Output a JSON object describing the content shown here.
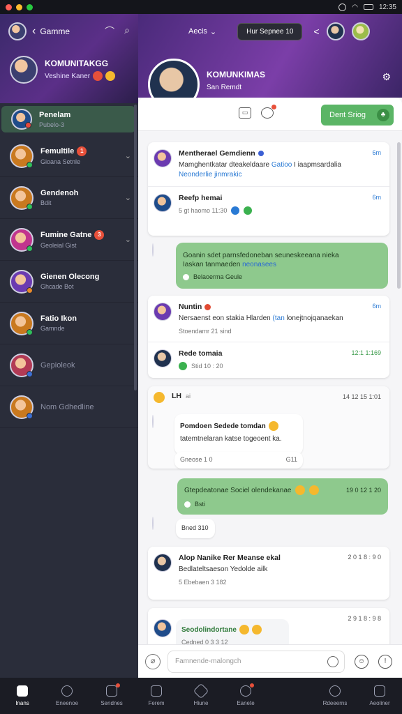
{
  "system": {
    "clock": "12:35"
  },
  "sidebar": {
    "header_title": "Gamme",
    "profile": {
      "title": "KOMUNITAKGG",
      "subtitle": "Veshine Kaner"
    },
    "friends": [
      {
        "name": "Penelam",
        "sub": "Pubelo-3",
        "active": true
      },
      {
        "name": "Femultile",
        "sub": "Gioana Setnle",
        "badge": "1"
      },
      {
        "name": "Gendenoh",
        "sub": "Bdit"
      },
      {
        "name": "Fumine Gatne",
        "sub": "Geoleial Gist",
        "badge": "3"
      },
      {
        "name": "Gienen Olecong",
        "sub": "Ghcade Bot"
      },
      {
        "name": "Fatio Ikon",
        "sub": "Gamnde"
      },
      {
        "name": "Gepioleok",
        "sub": "",
        "dim": true
      },
      {
        "name": "Nom Gdhedline",
        "sub": "",
        "dim": true
      }
    ]
  },
  "header": {
    "tab_label": "Aecis",
    "pill_label": "Hur Sepnee 10",
    "profile": {
      "title": "KOMUNKIMAS",
      "subtitle": "San Remdt"
    },
    "action_button": "Dent Sriog",
    "notif_count": "3"
  },
  "feed": {
    "card1": {
      "row1": {
        "title": "Mentherael Gemdienn",
        "text_a": "Mamghentkatar dteakeldaare ",
        "text_link": "Gatioo",
        "text_b": " I iaapmsardalia",
        "text_link2": "Neonderlie jinmrakic",
        "time": "6m"
      },
      "row2": {
        "title": "Reefp hemai",
        "meta": "5 gt haomo 11:30",
        "time": "6m"
      }
    },
    "green1": {
      "text_a": "Goanin sdet parnsfedoneban seuneskeeana nieka",
      "text_b": "Iaskan tanmaeden ",
      "text_link": "neonasees",
      "meta": "Belaoerma Geule"
    },
    "card2": {
      "row1": {
        "title": "Nuntin",
        "text_a": "Nersaenst eon stakia Hlarden ",
        "text_link": "(tan",
        "text_b": " lonejtnojqanaekan",
        "meta": "Stoendamr 21 sind",
        "time": "6m"
      },
      "row2": {
        "title": "Rede tomaia",
        "meta": "Stid 10 : 20",
        "time": "12:1 1:169"
      }
    },
    "group": {
      "name": "LH",
      "tag": "ai",
      "time": "14 12 15 1:01"
    },
    "white1": {
      "title": "Pomdoen Sedede tomdan",
      "text": "tatemtnelaran katse togeoent ka.",
      "meta": "Gneose 1 0",
      "tag": "G11"
    },
    "green2": {
      "text": "Gtepdeatonae Sociel olendekanae",
      "time": "19 0 12 1 20",
      "meta": "Bsti"
    },
    "small_reply": {
      "text": "Bned 310"
    },
    "card3": {
      "title": "Alop Nanike Rer Meanse ekal",
      "text": "Bedlateltsaeson Yedolde ailk",
      "meta": "5 Ebebaen 3 182",
      "time": "2 0 1 8 : 9 0"
    },
    "card4": {
      "title": "Seodolindortane",
      "meta": "Cedned 0 3 3 12",
      "time": "2 9 1 8 : 9 8"
    }
  },
  "composer": {
    "placeholder": "Famnende-malongch"
  },
  "bottom_nav": [
    {
      "label": "Inans",
      "active": true
    },
    {
      "label": "Eneenoe"
    },
    {
      "label": "Sendnes",
      "dot": true
    },
    {
      "label": "Ferem"
    },
    {
      "label": "Hiune"
    },
    {
      "label": "Eanete",
      "dot": true
    },
    {
      "label": "Rdeeerns"
    },
    {
      "label": "Aeoliner"
    }
  ]
}
